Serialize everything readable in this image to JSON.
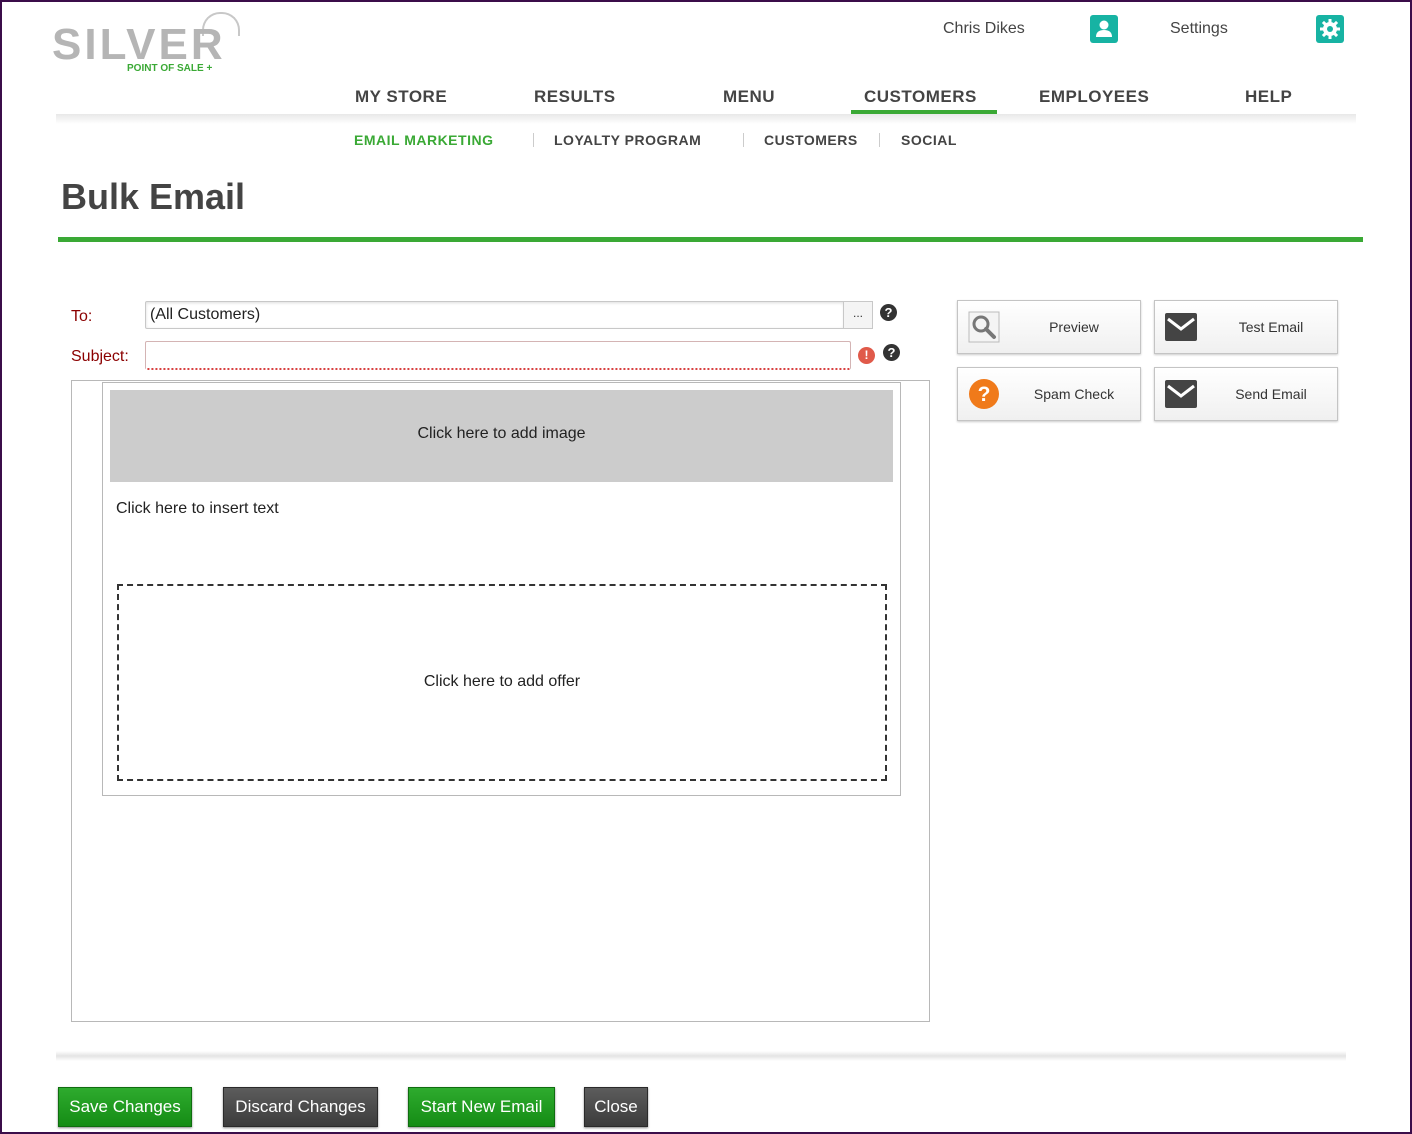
{
  "brand": {
    "name": "SILVER",
    "tagline": "POINT OF SALE +"
  },
  "user": {
    "name": "Chris Dikes",
    "settings_label": "Settings"
  },
  "main_nav": [
    "MY STORE",
    "RESULTS",
    "MENU",
    "CUSTOMERS",
    "EMPLOYEES",
    "HELP"
  ],
  "main_nav_active": "CUSTOMERS",
  "sub_nav": [
    "EMAIL MARKETING",
    "LOYALTY PROGRAM",
    "CUSTOMERS",
    "SOCIAL"
  ],
  "sub_nav_active": "EMAIL MARKETING",
  "page": {
    "title": "Bulk Email"
  },
  "form": {
    "to_label": "To:",
    "to_value": "(All Customers)",
    "browse_label": "...",
    "subject_label": "Subject:",
    "subject_value": "",
    "help_glyph": "?",
    "error_glyph": "!"
  },
  "editor": {
    "image_placeholder": "Click here to add image",
    "text_placeholder": "Click here to insert text",
    "offer_placeholder": "Click here to add offer"
  },
  "actions": {
    "preview": "Preview",
    "test_email": "Test Email",
    "spam_check": "Spam Check",
    "send_email": "Send Email"
  },
  "footer": {
    "save": "Save Changes",
    "discard": "Discard Changes",
    "start_new": "Start New Email",
    "close": "Close"
  },
  "colors": {
    "accent": "#3aa935",
    "teal": "#17b3a3",
    "orange": "#f07a1a",
    "error": "#8b0000"
  }
}
